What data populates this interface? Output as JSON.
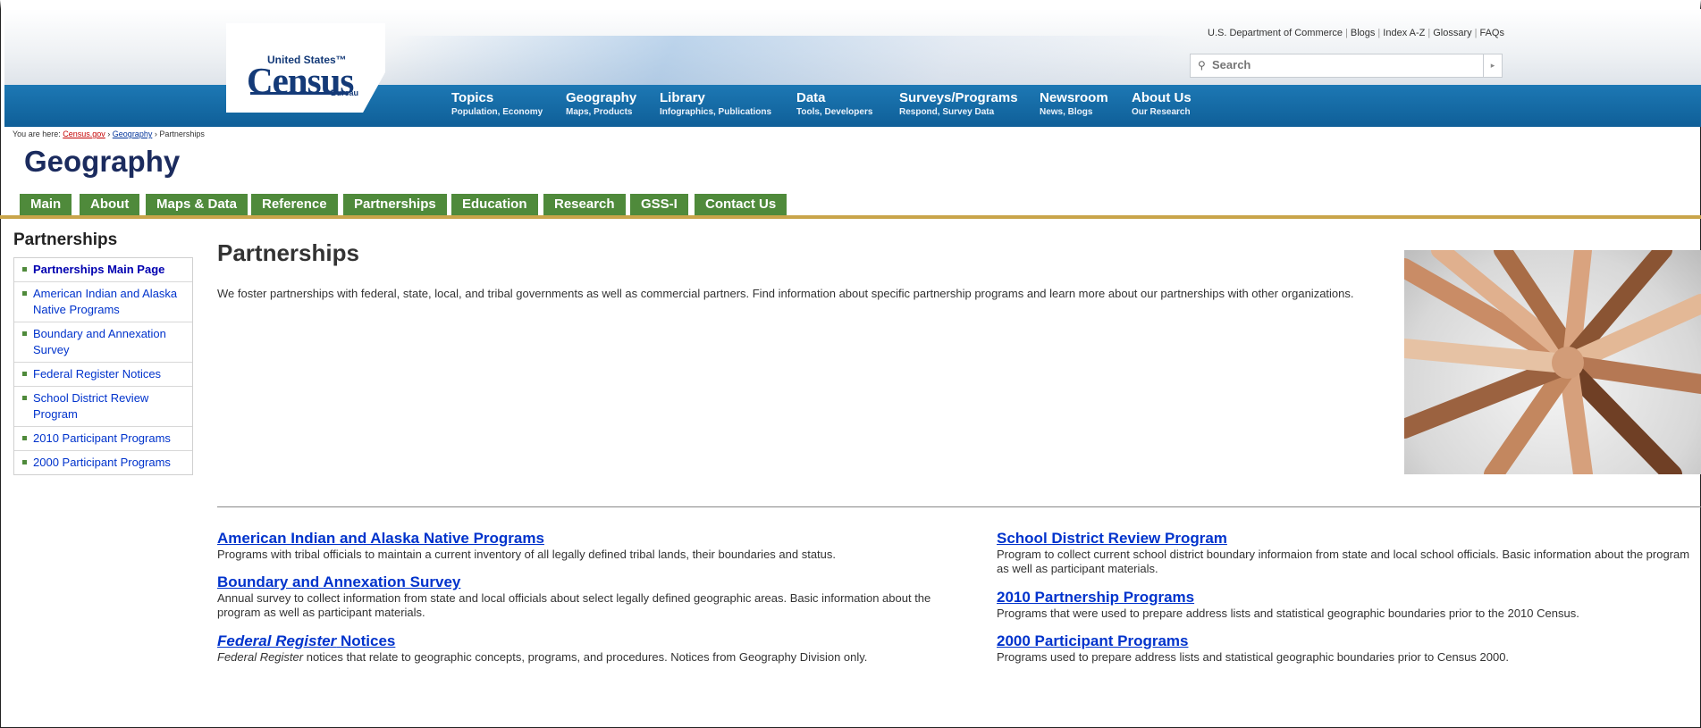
{
  "header": {
    "logo": {
      "united_states": "United States™",
      "census": "Census",
      "bureau": "Bureau"
    },
    "utility_links": [
      "U.S. Department of Commerce",
      "Blogs",
      "Index A-Z",
      "Glossary",
      "FAQs"
    ],
    "search": {
      "placeholder": "Search"
    },
    "nav": [
      {
        "title": "Topics",
        "sub": "Population, Economy"
      },
      {
        "title": "Geography",
        "sub": "Maps, Products"
      },
      {
        "title": "Library",
        "sub": "Infographics, Publications"
      },
      {
        "title": "Data",
        "sub": "Tools, Developers"
      },
      {
        "title": "Surveys/Programs",
        "sub": "Respond, Survey Data"
      },
      {
        "title": "Newsroom",
        "sub": "News, Blogs"
      },
      {
        "title": "About Us",
        "sub": "Our Research"
      }
    ]
  },
  "breadcrumb": {
    "prefix": "You are here:",
    "items": [
      "Census.gov",
      "Geography",
      "Partnerships"
    ],
    "sep": "›"
  },
  "section_title": "Geography",
  "subnav": [
    "Main",
    "About",
    "Maps & Data",
    "Reference",
    "Partnerships",
    "Education",
    "Research",
    "GSS-I",
    "Contact Us"
  ],
  "sidebar": {
    "title": "Partnerships",
    "items": [
      "Partnerships Main Page",
      "American Indian and Alaska Native Programs",
      "Boundary and Annexation Survey",
      "Federal Register Notices",
      "School District Review Program",
      "2010 Participant Programs",
      "2000 Participant Programs"
    ]
  },
  "main": {
    "title": "Partnerships",
    "intro": "We foster partnerships with federal, state, local, and tribal governments as well as commercial partners.  Find information about specific partnership programs and learn more about our partnerships with other organizations.",
    "programs_left": [
      {
        "title": "American Indian and Alaska Native Programs",
        "desc": "Programs with tribal officials to maintain a current inventory of all legally defined tribal lands, their boundaries and status."
      },
      {
        "title": "Boundary and Annexation Survey",
        "desc": "Annual survey to collect information from state and local officials about select legally defined geographic areas. Basic information about the program as well as participant materials."
      },
      {
        "title_italic": "Federal Register",
        "title_rest": " Notices",
        "desc_italic": "Federal Register",
        "desc_rest": " notices that relate to geographic concepts, programs, and procedures. Notices from Geography Division only."
      }
    ],
    "programs_right": [
      {
        "title": "School District Review Program",
        "desc": "Program to collect current school district boundary informaion from state and local school officials. Basic information about the program as well as participant materials."
      },
      {
        "title": "2010 Partnership Programs",
        "desc": "Programs that were used to prepare address lists and statistical geographic boundaries prior to the 2010 Census."
      },
      {
        "title": "2000 Participant Programs",
        "desc": "Programs used to prepare address lists and statistical geographic boundaries prior to Census 2000."
      }
    ]
  },
  "colors": {
    "nav_blue": "#1672ad",
    "subnav_green": "#4f8a3b",
    "gold": "#c9a54a",
    "link": "#0033cc"
  }
}
